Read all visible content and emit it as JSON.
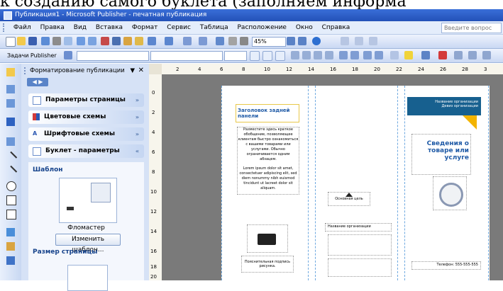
{
  "caption": "к созданию самого буклета (заполняем информа",
  "window": {
    "title": "Публикация1 - Microsoft Publisher - печатная публикация"
  },
  "menu": [
    "Файл",
    "Правка",
    "Вид",
    "Вставка",
    "Формат",
    "Сервис",
    "Таблица",
    "Расположение",
    "Окно",
    "Справка"
  ],
  "help_placeholder": "Введите вопрос",
  "toolbar": {
    "zoom": "45%"
  },
  "toolbar2": {
    "tasks_label": "Задачи Publisher"
  },
  "taskpane": {
    "title": "Форматирование публикации",
    "sections": [
      {
        "label": "Параметры страницы"
      },
      {
        "label": "Цветовые схемы"
      },
      {
        "label": "Шрифтовые схемы"
      },
      {
        "label": "Буклет - параметры"
      }
    ],
    "template_heading": "Шаблон",
    "template_name": "Фломастер",
    "change_template_button": "Изменить шаблон...",
    "page_size_heading": "Размер страницы"
  },
  "ruler": {
    "top_ticks": [
      "2",
      "4",
      "6",
      "8",
      "10",
      "12",
      "14",
      "16",
      "18",
      "20",
      "22",
      "24",
      "26",
      "28",
      "3"
    ],
    "left_ticks": [
      "0",
      "2",
      "4",
      "6",
      "8",
      "10",
      "12",
      "14",
      "16",
      "18",
      "20"
    ]
  },
  "brochure": {
    "back_heading": "Заголовок задней панели",
    "back_text": "Разместите здесь краткое обобщение, позволяющее клиентам быстро ознакомиться с вашими товарами или услугами. Обычно ограничивается одним абзацем.",
    "lorem": "Lorem ipsum dolor sit amet, consectetuer adipiscing elit, sed diem nonummy nibh euismod tincidunt ut lacreet dolor sit aliquam.",
    "image_caption": "Пояснительная подпись рисунка.",
    "center_org": "Название организации",
    "center_slogan": "Основная цель",
    "front_org": "Название организации",
    "front_sub": "Девиз организации",
    "front_title": "Сведения о товаре или услуге",
    "front_phone": "Телефон: 555-555-555"
  }
}
